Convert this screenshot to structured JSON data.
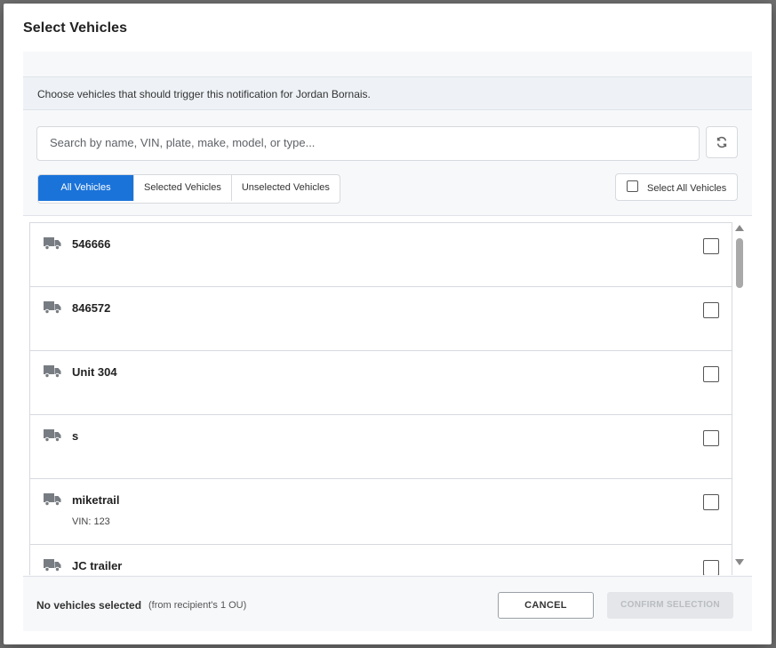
{
  "dialog": {
    "title": "Select Vehicles",
    "info_text": "Choose vehicles that should trigger this notification for Jordan Bornais."
  },
  "search": {
    "placeholder": "Search by name, VIN, plate, make, model, or type...",
    "value": "",
    "refresh_icon": "refresh-icon"
  },
  "filters": {
    "tabs": [
      {
        "label": "All Vehicles",
        "active": true
      },
      {
        "label": "Selected Vehicles",
        "active": false
      },
      {
        "label": "Unselected Vehicles",
        "active": false
      }
    ],
    "select_all_label": "Select All Vehicles",
    "select_all_checked": false
  },
  "vehicles": [
    {
      "name": "546666",
      "vin": "",
      "icon": "truck-icon",
      "checked": false
    },
    {
      "name": "846572",
      "vin": "",
      "icon": "truck-icon",
      "checked": false
    },
    {
      "name": "Unit 304",
      "vin": "",
      "icon": "truck-icon",
      "checked": false
    },
    {
      "name": "s",
      "vin": "",
      "icon": "truck-icon",
      "checked": false
    },
    {
      "name": "miketrail",
      "vin": "VIN: 123",
      "icon": "truck-icon",
      "checked": false
    },
    {
      "name": "JC trailer",
      "vin": "",
      "icon": "truck-icon",
      "checked": false
    }
  ],
  "footer": {
    "selection_summary": "No vehicles selected",
    "scope_note": "(from recipient's 1 OU)",
    "cancel_label": "CANCEL",
    "confirm_label": "CONFIRM SELECTION",
    "confirm_enabled": false
  },
  "colors": {
    "accent": "#1a73d9",
    "icon": "#777c82"
  }
}
